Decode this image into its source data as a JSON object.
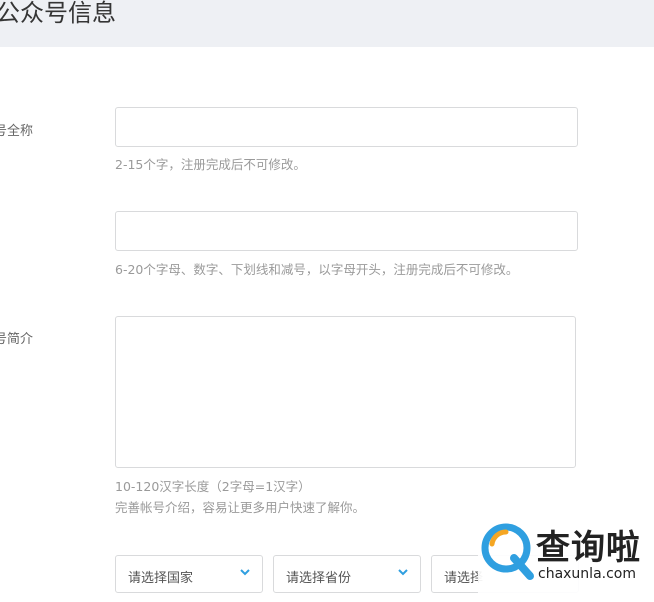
{
  "header": {
    "title": "公众号信息"
  },
  "form": {
    "name": {
      "label": "号全称",
      "value": "",
      "hint": "2-15个字，注册完成后不可修改。"
    },
    "account": {
      "value": "",
      "hint": "6-20个字母、数字、下划线和减号，以字母开头，注册完成后不可修改。"
    },
    "intro": {
      "label": "号简介",
      "value": "",
      "hint_line1": "10-120汉字长度（2字母=1汉字）",
      "hint_line2": "完善帐号介绍，容易让更多用户快速了解你。"
    },
    "location": {
      "country_placeholder": "请选择国家",
      "province_placeholder": "请选择省份",
      "city_placeholder": "请选择"
    }
  },
  "watermark": {
    "brand": "查询啦",
    "domain": "chaxunla.com"
  },
  "colors": {
    "accent": "#2f9fe0",
    "logo_orange": "#f5a623",
    "header_bg": "#eef0f4"
  }
}
